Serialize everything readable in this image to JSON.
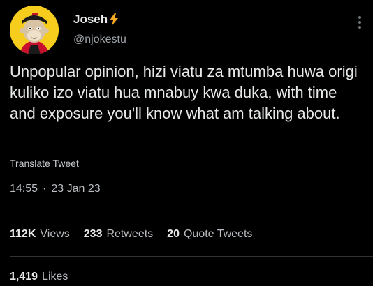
{
  "author": {
    "name": "Joseh",
    "handle": "@njokestu",
    "verified_emoji": "lightning-bolt-icon"
  },
  "tweet": {
    "text": "Unpopular opinion, hizi viatu za mtumba huwa origi kuliko izo viatu hua mnabuy kwa duka, with time and exposure you'll know what am talking about.",
    "translate_label": "Translate Tweet",
    "time": "14:55",
    "separator": "·",
    "date": "23 Jan 23"
  },
  "stats": {
    "views_count": "112K",
    "views_label": "Views",
    "retweets_count": "233",
    "retweets_label": "Retweets",
    "quotes_count": "20",
    "quotes_label": "Quote Tweets",
    "likes_count": "1,419",
    "likes_label": "Likes"
  },
  "colors": {
    "background": "#000000",
    "text": "#e7e9ea",
    "muted": "#71767b",
    "avatar_bg": "#f6cd1c",
    "bolt": "#f7a823"
  }
}
